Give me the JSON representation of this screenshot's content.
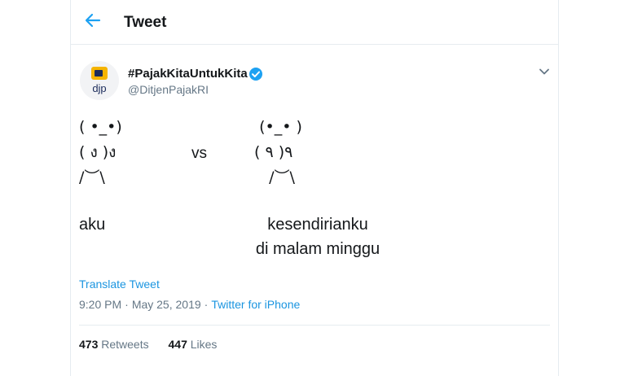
{
  "header": {
    "title": "Tweet"
  },
  "author": {
    "avatar_text": "djp",
    "display_name": "#PajakKitaUntukKita",
    "handle": "@DitjenPajakRI"
  },
  "tweet": {
    "art_left": "( •_•)\n( ง )ง\n/︶\\",
    "art_vs": "vs",
    "art_right": "  (•_• )\n ٩( ٩ )\n    /︶\\",
    "caption_left": "aku",
    "caption_right": "kesendirianku\ndi malam minggu"
  },
  "translate_label": "Translate Tweet",
  "meta": {
    "time": "9:20 PM",
    "date": "May 25, 2019",
    "separator": "·",
    "source": "Twitter for iPhone"
  },
  "stats": {
    "retweets_count": "473",
    "retweets_label": "Retweets",
    "likes_count": "447",
    "likes_label": "Likes"
  },
  "colors": {
    "accent": "#1da1f2",
    "link": "#1b95e0",
    "muted": "#657786",
    "logo_yellow": "#f5b400",
    "logo_navy": "#1c2c5b"
  },
  "icons": [
    "back-arrow-icon",
    "verified-badge-icon",
    "chevron-down-icon"
  ]
}
